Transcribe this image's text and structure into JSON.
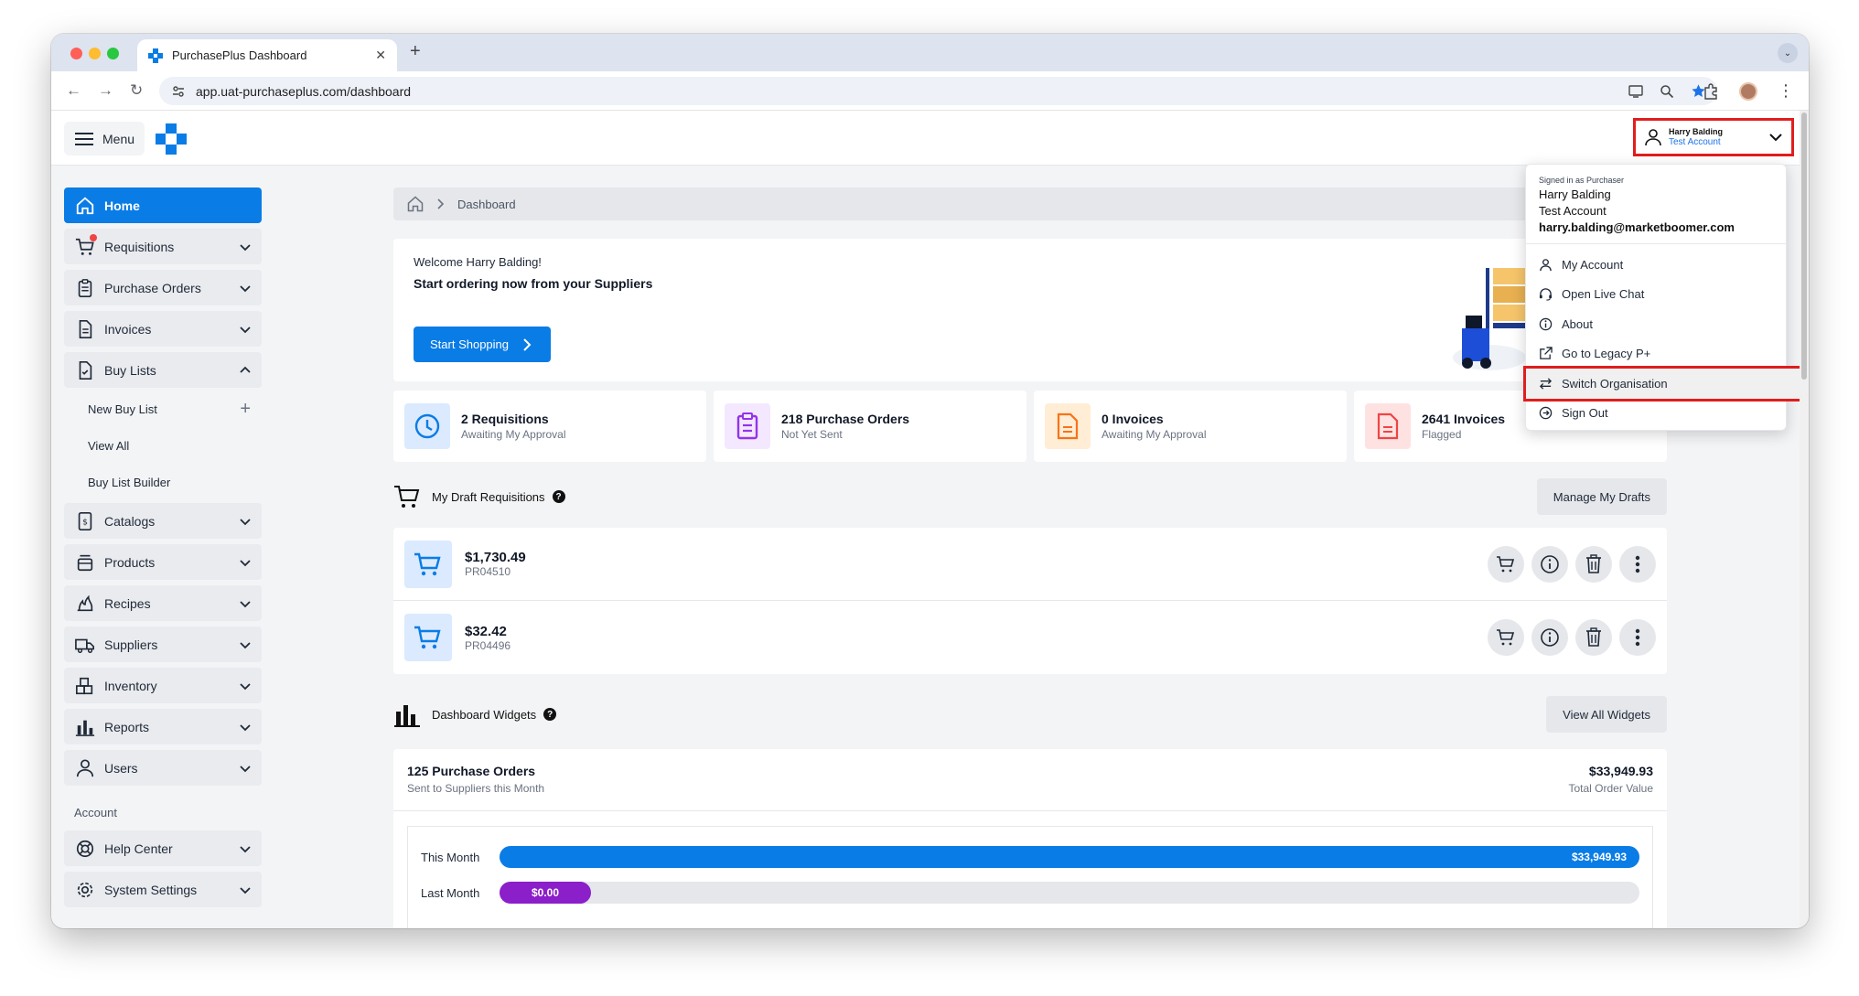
{
  "browser": {
    "tab_title": "PurchasePlus Dashboard",
    "tab_close": "✕",
    "new_tab": "+",
    "tab_menu": "⌄",
    "url": "app.uat-purchaseplus.com/dashboard",
    "back": "←",
    "forward": "→",
    "reload": "↻",
    "menu_dots": "⋮"
  },
  "header": {
    "menu_label": "Menu",
    "user_name": "Harry Balding",
    "user_account": "Test Account"
  },
  "dropdown": {
    "signed_in_as": "Signed in as Purchaser",
    "name": "Harry Balding",
    "account": "Test Account",
    "email": "harry.balding@marketboomer.com",
    "items": [
      {
        "label": "My Account",
        "icon": "user-icon"
      },
      {
        "label": "Open Live Chat",
        "icon": "headset-icon"
      },
      {
        "label": "About",
        "icon": "info-icon"
      },
      {
        "label": "Go to Legacy P+",
        "icon": "external-link-icon"
      },
      {
        "label": "Switch Organisation",
        "icon": "switch-icon"
      },
      {
        "label": "Sign Out",
        "icon": "sign-out-icon"
      }
    ]
  },
  "sidebar": {
    "items": [
      {
        "label": "Home",
        "icon": "home-icon"
      },
      {
        "label": "Requisitions",
        "icon": "cart-icon"
      },
      {
        "label": "Purchase Orders",
        "icon": "clipboard-icon"
      },
      {
        "label": "Invoices",
        "icon": "document-icon"
      },
      {
        "label": "Buy Lists",
        "icon": "checklist-icon"
      }
    ],
    "buy_list_sub": [
      {
        "label": "New Buy List",
        "extra": "+"
      },
      {
        "label": "View All"
      },
      {
        "label": "Buy List Builder"
      }
    ],
    "items2": [
      {
        "label": "Catalogs",
        "icon": "catalog-icon"
      },
      {
        "label": "Products",
        "icon": "products-icon"
      },
      {
        "label": "Recipes",
        "icon": "recipes-icon"
      },
      {
        "label": "Suppliers",
        "icon": "truck-icon"
      },
      {
        "label": "Inventory",
        "icon": "boxes-icon"
      },
      {
        "label": "Reports",
        "icon": "bar-chart-icon"
      },
      {
        "label": "Users",
        "icon": "user-icon"
      }
    ],
    "account_heading": "Account",
    "account_items": [
      {
        "label": "Help Center",
        "icon": "lifebuoy-icon"
      },
      {
        "label": "System Settings",
        "icon": "gear-icon"
      }
    ]
  },
  "main": {
    "breadcrumb": "Dashboard",
    "welcome_line1": "Welcome Harry Balding!",
    "welcome_line2": "Start ordering now from your Suppliers",
    "start_shopping": "Start Shopping",
    "stats": [
      {
        "title": "2 Requisitions",
        "sub": "Awaiting My Approval",
        "color": "#0a7ce6"
      },
      {
        "title": "218 Purchase Orders",
        "sub": "Not Yet Sent",
        "color": "#9333ea"
      },
      {
        "title": "0 Invoices",
        "sub": "Awaiting My Approval",
        "color": "#f97316"
      },
      {
        "title": "2641 Invoices",
        "sub": "Flagged",
        "color": "#ef4444"
      }
    ],
    "drafts_title": "My Draft Requisitions",
    "help_mark": "?",
    "manage_drafts": "Manage My Drafts",
    "drafts": [
      {
        "amount": "$1,730.49",
        "ref": "PR04510"
      },
      {
        "amount": "$32.42",
        "ref": "PR04496"
      }
    ],
    "widgets_title": "Dashboard Widgets",
    "view_all_widgets": "View All Widgets",
    "widget": {
      "title": "125 Purchase Orders",
      "sub": "Sent to Suppliers this Month",
      "value": "$33,949.93",
      "value_label": "Total Order Value"
    }
  },
  "chart_data": {
    "type": "bar",
    "categories": [
      "This Month",
      "Last Month"
    ],
    "values": [
      33949.93,
      0
    ],
    "value_labels": [
      "$33,949.93",
      "$0.00"
    ],
    "colors": [
      "#0a7ce6",
      "#8b1fc9"
    ]
  }
}
